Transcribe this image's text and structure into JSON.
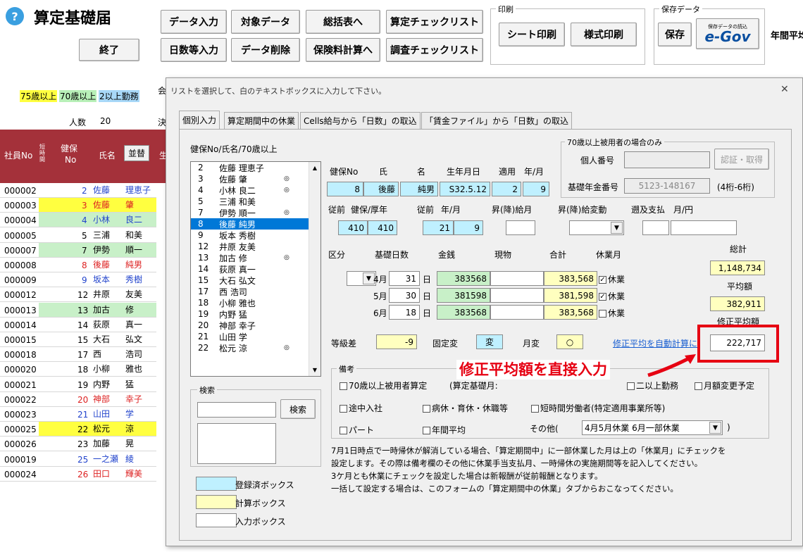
{
  "app": {
    "title": "算定基礎届",
    "exit": "終了",
    "help_icon": "?"
  },
  "toolbar": {
    "b1": "データ入力",
    "b2": "対象データ",
    "b3": "総括表へ",
    "b4": "算定チェックリスト",
    "b5": "日数等入力",
    "b6": "データ削除",
    "b7": "保険料計算へ",
    "b8": "調査チェックリスト",
    "print_group": "印刷",
    "sheet_print": "シート印刷",
    "form_print": "様式印刷",
    "save_group": "保存データ",
    "save": "保存",
    "egov_small": "保存データの読込",
    "egov": "e-Gov",
    "annual": "年間平均"
  },
  "legend": {
    "a75": "75歳以上",
    "a70": "70歳以上",
    "dual": "2以上勤務",
    "count_label": "人数",
    "count": "20",
    "partial": "会",
    "partial2": "決"
  },
  "roster_header": {
    "emp_no": "社員No",
    "short": "短時間",
    "kenpo": "健保",
    "no": "No",
    "name": "氏名",
    "sort": "並替",
    "more": "生"
  },
  "roster": [
    {
      "emp": "000002",
      "no": "2",
      "last": "佐藤",
      "first": "理恵子",
      "c": "#2244cc",
      "m": ""
    },
    {
      "emp": "000003",
      "no": "3",
      "last": "佐藤",
      "first": "肇",
      "c": "#dd2222",
      "m": "yl"
    },
    {
      "emp": "000004",
      "no": "4",
      "last": "小林",
      "first": "良二",
      "c": "#2244cc",
      "m": "gr"
    },
    {
      "emp": "000005",
      "no": "5",
      "last": "三浦",
      "first": "和美",
      "c": "#000",
      "m": ""
    },
    {
      "emp": "000007",
      "no": "7",
      "last": "伊勢",
      "first": "順一",
      "c": "#000",
      "m": "gr"
    },
    {
      "emp": "000008",
      "no": "8",
      "last": "後藤",
      "first": "純男",
      "c": "#dd2222",
      "m": ""
    },
    {
      "emp": "000009",
      "no": "9",
      "last": "坂本",
      "first": "秀樹",
      "c": "#2244cc",
      "m": ""
    },
    {
      "emp": "000012",
      "no": "12",
      "last": "井原",
      "first": "友美",
      "c": "#000",
      "m": ""
    },
    {
      "emp": "000013",
      "no": "13",
      "last": "加古",
      "first": "修",
      "c": "#000",
      "m": "gr"
    },
    {
      "emp": "000014",
      "no": "14",
      "last": "荻原",
      "first": "真一",
      "c": "#000",
      "m": ""
    },
    {
      "emp": "000015",
      "no": "15",
      "last": "大石",
      "first": "弘文",
      "c": "#000",
      "m": ""
    },
    {
      "emp": "000018",
      "no": "17",
      "last": "西",
      "first": "浩司",
      "c": "#000",
      "m": ""
    },
    {
      "emp": "000020",
      "no": "18",
      "last": "小柳",
      "first": "雅也",
      "c": "#000",
      "m": ""
    },
    {
      "emp": "000021",
      "no": "19",
      "last": "内野",
      "first": "猛",
      "c": "#000",
      "m": ""
    },
    {
      "emp": "000022",
      "no": "20",
      "last": "神部",
      "first": "幸子",
      "c": "#dd2222",
      "m": ""
    },
    {
      "emp": "000023",
      "no": "21",
      "last": "山田",
      "first": "学",
      "c": "#2244cc",
      "m": ""
    },
    {
      "emp": "000025",
      "no": "22",
      "last": "松元",
      "first": "涼",
      "c": "#000",
      "m": "yl"
    },
    {
      "emp": "000026",
      "no": "23",
      "last": "加藤",
      "first": "晃",
      "c": "#000",
      "m": ""
    },
    {
      "emp": "000019",
      "no": "25",
      "last": "一之瀬",
      "first": "綾",
      "c": "#2244cc",
      "m": ""
    },
    {
      "emp": "000024",
      "no": "26",
      "last": "田口",
      "first": "輝美",
      "c": "#dd2222",
      "m": ""
    }
  ],
  "dialog": {
    "instruction": "リストを選択して、白のテキストボックスに入力して下さい。",
    "close_icon": "✕",
    "tabs": [
      "個別入力",
      "算定期間中の休業",
      "Cells給与から「日数」の取込",
      "「賃金ファイル」から「日数」の取込"
    ],
    "list_label": "健保No/氏名/70歳以上",
    "list": [
      {
        "n": "2",
        "name": "佐藤 理恵子",
        "o": ""
      },
      {
        "n": "3",
        "name": "佐藤 肇",
        "o": "◎"
      },
      {
        "n": "4",
        "name": "小林 良二",
        "o": "◎"
      },
      {
        "n": "5",
        "name": "三浦 和美",
        "o": ""
      },
      {
        "n": "7",
        "name": "伊勢 順一",
        "o": "◎"
      },
      {
        "n": "8",
        "name": "後藤 純男",
        "o": ""
      },
      {
        "n": "9",
        "name": "坂本 秀樹",
        "o": ""
      },
      {
        "n": "12",
        "name": "井原 友美",
        "o": ""
      },
      {
        "n": "13",
        "name": "加古 修",
        "o": "◎"
      },
      {
        "n": "14",
        "name": "荻原 真一",
        "o": ""
      },
      {
        "n": "15",
        "name": "大石 弘文",
        "o": ""
      },
      {
        "n": "17",
        "name": "西 浩司",
        "o": ""
      },
      {
        "n": "18",
        "name": "小柳 雅也",
        "o": ""
      },
      {
        "n": "19",
        "name": "内野 猛",
        "o": ""
      },
      {
        "n": "20",
        "name": "神部 幸子",
        "o": ""
      },
      {
        "n": "21",
        "name": "山田 学",
        "o": ""
      },
      {
        "n": "22",
        "name": "松元 涼",
        "o": "◎"
      }
    ],
    "search_group": "検索",
    "search_btn": "検索",
    "legend_reg": "登録済ボックス",
    "legend_calc": "計算ボックス",
    "legend_input": "入力ボックス",
    "head": {
      "kenpo": "健保No",
      "last": "氏",
      "first": "名",
      "birth": "生年月日",
      "apply": "適用",
      "ym": "年/月"
    },
    "vals": {
      "kenpo": "8",
      "last": "後藤",
      "first": "純男",
      "birth": "S32.5.12",
      "apply_y": "2",
      "apply_m": "9"
    },
    "prev": {
      "label1": "従前",
      "label2": "健保/厚年",
      "k": "410",
      "n": "410",
      "label3": "従前",
      "label4": "年/月",
      "y": "21",
      "m": "9",
      "raise": "昇(降)給月",
      "raise_chg": "昇(降)給変動",
      "retro": "遡及支払",
      "retro_ym": "月/円"
    },
    "sec70": {
      "title": "70歳以上被用者の場合のみ",
      "mynum": "個人番号",
      "auth": "認証・取得",
      "pension": "基礎年金番号",
      "pension_val": "5123-148167",
      "pension_note": "(4桁-6桁)"
    },
    "cols": {
      "kubun": "区分",
      "days": "基礎日数",
      "cash": "金銭",
      "kind": "現物",
      "total": "合計",
      "leave": "休業月",
      "sum": "総計",
      "avg": "平均額",
      "mod": "修正平均額"
    },
    "months": [
      {
        "m": "4月",
        "d": "31",
        "cash": "383568",
        "total": "383,568",
        "chk": true,
        "leave": "休業"
      },
      {
        "m": "5月",
        "d": "30",
        "cash": "381598",
        "total": "381,598",
        "chk": true,
        "leave": "休業"
      },
      {
        "m": "6月",
        "d": "18",
        "cash": "383568",
        "total": "383,568",
        "chk": false,
        "leave": "休業"
      }
    ],
    "day_unit": "日",
    "sum_val": "1,148,734",
    "avg_val": "382,911",
    "mod_val": "222,717",
    "grade": {
      "label": "等級差",
      "val": "-9",
      "fixed": "固定変",
      "fixed_val": "変",
      "mchg": "月変",
      "mchg_val": "○",
      "auto": "修正平均を自動計算に"
    },
    "notes": {
      "title": "備考",
      "c1": "70歳以上被用者算定",
      "c2": "(算定基礎月:",
      "c5": "二以上勤務",
      "c6": "月額変更予定",
      "c7": "途中入社",
      "c8": "病休・育休・休職等",
      "c9": "短時間労働者(特定適用事業所等)",
      "c10": "パート",
      "c11": "年間平均",
      "other": "その他(",
      "other_val": "4月5月休業 6月一部休業",
      "close_paren": ")"
    },
    "info": [
      "7月1日時点で一時帰休が解消している場合、「算定期間中」に一部休業した月は上の「休業月」にチェックを",
      "設定します。その際は備考欄のその他に休業手当支払月、一時帰休の実施期間等を記入してください。",
      "3ケ月とも休業にチェックを設定した場合は新報酬が従前報酬となります。",
      "一括して設定する場合は、このフォームの「算定期間中の休業」タブからおこなってください。"
    ]
  },
  "annotation": "修正平均額を直接入力",
  "colors": {
    "header": "#a4313a",
    "cyan": "#bff0ff",
    "yellow": "#ffffbf",
    "green": "#c8f0c8",
    "red": "#e60012"
  }
}
